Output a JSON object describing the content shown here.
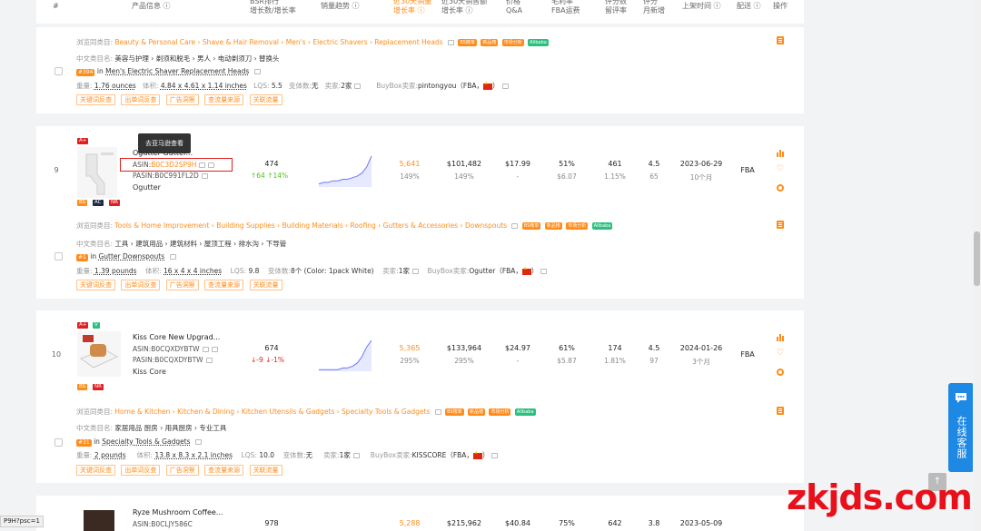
{
  "header": {
    "col_num": "#",
    "col_product": "产品信息 ⓘ",
    "col_bsr": "BSR排行\n增长数/增长率",
    "col_trend": "销量趋势 ⓘ",
    "col_sales": "近30天销量\n增长率 ⓘ",
    "col_revenue": "近30天销售额\n增长率 ⓘ",
    "col_price": "价格\nQ&A",
    "col_fba": "毛利率\nFBA运费",
    "col_ratings": "评分数\n留评率",
    "col_rating": "评分\n月新增",
    "col_date": "上架时间 ⓘ",
    "col_ship": "配送 ⓘ",
    "col_action": "操作"
  },
  "tags": [
    "关键词反查",
    "出单词反查",
    "广告洞察",
    "查流量来源",
    "关联流量"
  ],
  "labels": {
    "browse_prefix": "浏览同类目:",
    "cn_prefix": "中文类目名:",
    "weight": "重量:",
    "volume": "体积:",
    "lqs": "LQS:",
    "variants": "变体数:",
    "sellers": "卖家:",
    "buybox": "BuyBox卖家:",
    "bs_badge": "BS榜单",
    "new_badge": "新品榜",
    "market_badge": "市场分析",
    "alibaba_badge": "Alibaba",
    "in": "in"
  },
  "card1": {
    "browse": "Beauty & Personal Care › Shave & Hair Removal › Men's › Electric Shavers › Replacement Heads",
    "cn": "美容与护理 › 剃须和脱毛 › 男人 › 电动剃须刀 › 替换头",
    "rank": "#394",
    "rank_cat": "Men's Electric Shaver Replacement Heads",
    "weight": "1.76 ounces",
    "volume": "4.84 x 4.61 x 1.14 inches",
    "lqs": "5.5",
    "variants": "无",
    "sellers": "2家",
    "buybox": "pintongyou（FBA，",
    "buybox_end": "）"
  },
  "card2": {
    "index": "9",
    "title": "Ogutter Gutter...",
    "asin_label": "ASIN:",
    "asin": "B0C3D2SP9H",
    "pasin": "PASIN:B0C991FL2D",
    "brand": "Ogutter",
    "badges": [
      "A+",
      "BS",
      "AC",
      "NR"
    ],
    "bsr": "474",
    "bsr_up": "↑64",
    "bsr_rate": "↑14%",
    "sales": "5,641",
    "sales_rate": "149%",
    "revenue": "$101,482",
    "revenue_rate": "149%",
    "price": "$17.99",
    "qa": "-",
    "margin": "51%",
    "fba": "$6.07",
    "ratings": "461",
    "review_rate": "1.15%",
    "rating": "4.5",
    "monthly_new": "65",
    "date": "2023-06-29",
    "age": "10个月",
    "ship": "FBA",
    "tooltip": "去亚马逊查看",
    "browse": "Tools & Home Improvement › Building Supplies › Building Materials › Roofing › Gutters & Accessories › Downspouts",
    "cn": "工具 › 建筑用品 › 建筑材料 › 屋顶工程 › 排水沟 › 下导管",
    "rank": "#1",
    "rank_cat": "Gutter Downspouts",
    "weight": "1.39 pounds",
    "volume": "16 x 4 x 4 inches",
    "lqs": "9.8",
    "variants": "8个 (Color: 1pack White)",
    "sellers": "1家",
    "buybox": "Ogutter（FBA，",
    "buybox_end": "）",
    "trend": [
      2,
      3,
      3,
      4,
      4,
      5,
      5,
      6,
      7,
      9,
      13,
      20
    ]
  },
  "card3": {
    "index": "10",
    "title": "Kiss Core New Upgrad...",
    "asin": "ASIN:B0CQXDYBTW",
    "pasin": "PASIN:B0CQXDYBTW",
    "brand": "Kiss Core",
    "badges": [
      "A+",
      "V",
      "BS",
      "NR"
    ],
    "bsr": "674",
    "bsr_down": "↓-9",
    "bsr_rate": "↓-1%",
    "sales": "5,365",
    "sales_rate": "295%",
    "revenue": "$133,964",
    "revenue_rate": "295%",
    "price": "$24.97",
    "qa": "-",
    "margin": "61%",
    "fba": "$5.87",
    "ratings": "174",
    "review_rate": "1.81%",
    "rating": "4.5",
    "monthly_new": "97",
    "date": "2024-01-26",
    "age": "3个月",
    "ship": "FBA",
    "browse": "Home & Kitchen › Kitchen & Dining › Kitchen Utensils & Gadgets › Specialty Tools & Gadgets",
    "cn": "家居用品 厨房 › 用具厨房 › 专业工具",
    "rank": "#31",
    "rank_cat": "Specialty Tools & Gadgets",
    "weight": "2 pounds",
    "volume": "13.8 x 8.3 x 2.1 inches",
    "lqs": "10.0",
    "variants": "无",
    "sellers": "1家",
    "buybox": "KISSCORE（FBA，",
    "buybox_end": "）",
    "trend": [
      1,
      1,
      1,
      1,
      1,
      2,
      2,
      3,
      5,
      9,
      15,
      19
    ]
  },
  "card4": {
    "title": "Ryze Mushroom Coffee...",
    "asin": "ASIN:B0CLJY586C",
    "bsr": "978",
    "sales": "5,288",
    "revenue": "$215,962",
    "price": "$40.84",
    "margin": "75%",
    "ratings": "642",
    "rating": "3.8",
    "date": "2023-05-09"
  },
  "float_service": "在线客服",
  "watermark": "zkjds.com",
  "status_url": "P9H?psc=1",
  "to_top": "↑"
}
